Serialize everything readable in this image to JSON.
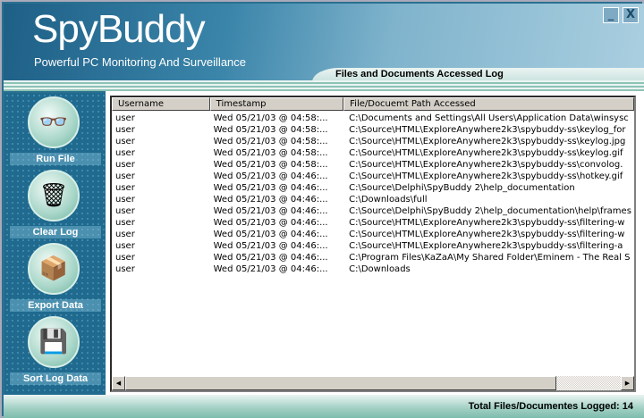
{
  "header": {
    "logo": "SpyBuddy",
    "tagline": "Powerful PC Monitoring And Surveillance",
    "section_title": "Files and Documents Accessed Log",
    "minimize": "_",
    "close": "X"
  },
  "sidebar": {
    "items": [
      {
        "label": "Run File",
        "icon": "glasses-document-icon",
        "glyph": "👓"
      },
      {
        "label": "Clear Log",
        "icon": "trash-icon",
        "glyph": "🗑"
      },
      {
        "label": "Export Data",
        "icon": "export-box-icon",
        "glyph": "📦"
      },
      {
        "label": "Sort Log Data",
        "icon": "sort-disk-icon",
        "glyph": "💾"
      }
    ]
  },
  "table": {
    "columns": [
      "Username",
      "Timestamp",
      "File/Docuemt Path Accessed"
    ],
    "rows": [
      [
        "user",
        "Wed 05/21/03 @ 04:58:...",
        "C:\\Documents and Settings\\All Users\\Application Data\\winsysc"
      ],
      [
        "user",
        "Wed 05/21/03 @ 04:58:...",
        "C:\\Source\\HTML\\ExploreAnywhere2k3\\spybuddy-ss\\keylog_for"
      ],
      [
        "user",
        "Wed 05/21/03 @ 04:58:...",
        "C:\\Source\\HTML\\ExploreAnywhere2k3\\spybuddy-ss\\keylog.jpg"
      ],
      [
        "user",
        "Wed 05/21/03 @ 04:58:...",
        "C:\\Source\\HTML\\ExploreAnywhere2k3\\spybuddy-ss\\keylog.gif"
      ],
      [
        "user",
        "Wed 05/21/03 @ 04:58:...",
        "C:\\Source\\HTML\\ExploreAnywhere2k3\\spybuddy-ss\\convolog."
      ],
      [
        "user",
        "Wed 05/21/03 @ 04:46:...",
        "C:\\Source\\HTML\\ExploreAnywhere2k3\\spybuddy-ss\\hotkey.gif"
      ],
      [
        "user",
        "Wed 05/21/03 @ 04:46:...",
        "C:\\Source\\Delphi\\SpyBuddy 2\\help_documentation"
      ],
      [
        "user",
        "Wed 05/21/03 @ 04:46:...",
        "C:\\Downloads\\full"
      ],
      [
        "user",
        "Wed 05/21/03 @ 04:46:...",
        "C:\\Source\\Delphi\\SpyBuddy 2\\help_documentation\\help\\frames"
      ],
      [
        "user",
        "Wed 05/21/03 @ 04:46:...",
        "C:\\Source\\HTML\\ExploreAnywhere2k3\\spybuddy-ss\\filtering-w"
      ],
      [
        "user",
        "Wed 05/21/03 @ 04:46:...",
        "C:\\Source\\HTML\\ExploreAnywhere2k3\\spybuddy-ss\\filtering-w"
      ],
      [
        "user",
        "Wed 05/21/03 @ 04:46:...",
        "C:\\Source\\HTML\\ExploreAnywhere2k3\\spybuddy-ss\\filtering-a"
      ],
      [
        "user",
        "Wed 05/21/03 @ 04:46:...",
        "C:\\Program Files\\KaZaA\\My Shared Folder\\Eminem - The Real S"
      ],
      [
        "user",
        "Wed 05/21/03 @ 04:46:...",
        "C:\\Downloads"
      ]
    ]
  },
  "scroll": {
    "left": "◀",
    "right": "▶"
  },
  "status": "Total Files/Documentes Logged: 14"
}
